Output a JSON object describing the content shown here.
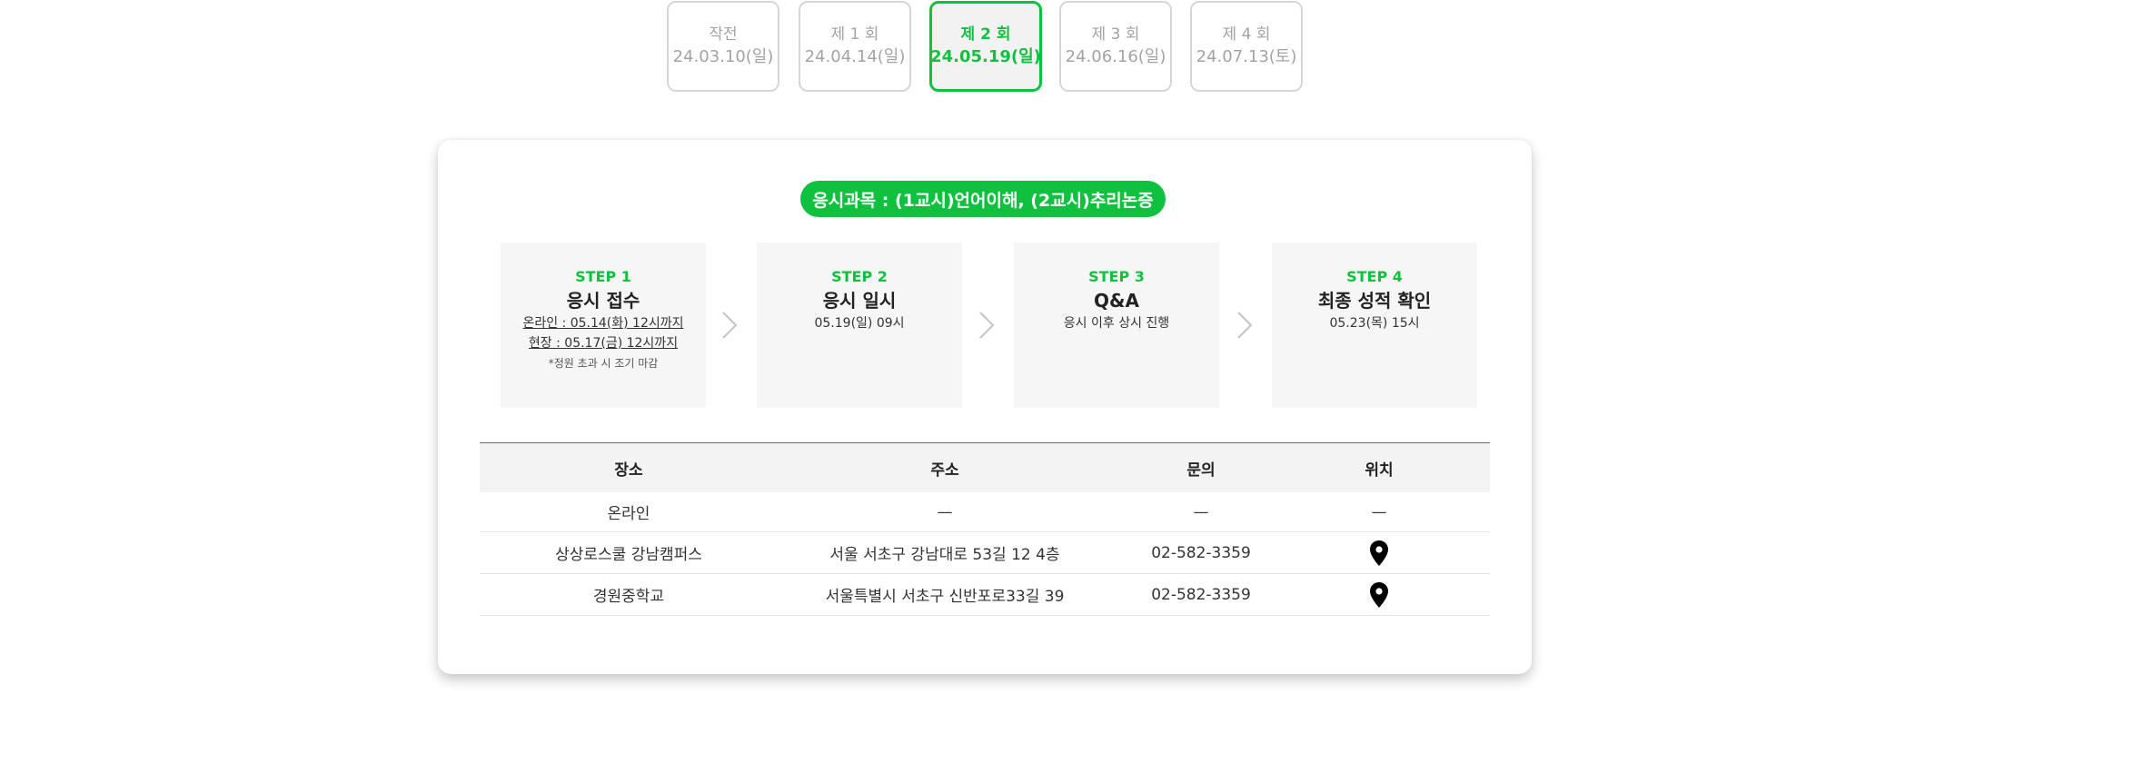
{
  "tabs": [
    {
      "label": "작전",
      "date": "24.03.10(일)",
      "active": false
    },
    {
      "label": "제 1 회",
      "date": "24.04.14(일)",
      "active": false
    },
    {
      "label": "제 2 회",
      "date": "24.05.19(일)",
      "active": true
    },
    {
      "label": "제 3 회",
      "date": "24.06.16(일)",
      "active": false
    },
    {
      "label": "제 4 회",
      "date": "24.07.13(토)",
      "active": false
    }
  ],
  "subject_banner": "응시과목 : (1교시)언어이해, (2교시)추리논증",
  "steps": [
    {
      "label": "STEP 1",
      "title": "응시 접수",
      "lines": [
        "온라인 : 05.14(화) 12시까지",
        "현장 : 05.17(금) 12시까지"
      ],
      "note": "*정원 초과 시 조기 마감"
    },
    {
      "label": "STEP 2",
      "title": "응시 일시",
      "lines": [
        "05.19(일) 09시"
      ]
    },
    {
      "label": "STEP 3",
      "title": "Q&A",
      "lines": [
        "응시 이후 상시 진행"
      ]
    },
    {
      "label": "STEP 4",
      "title": "최종 성적 확인",
      "lines": [
        "05.23(목) 15시"
      ]
    }
  ],
  "table": {
    "headers": [
      "장소",
      "주소",
      "문의",
      "위치"
    ],
    "rows": [
      {
        "place": "온라인",
        "address": "—",
        "contact": "—",
        "location": "—"
      },
      {
        "place": "상상로스쿨 강남캠퍼스",
        "address": "서울 서초구 강남대로 53길 12 4층",
        "contact": "02-582-3359",
        "location_icon": "map-pin-icon"
      },
      {
        "place": "경원중학교",
        "address": "서울특별시 서초구 신반포로33길 39",
        "contact": "02-582-3359",
        "location_icon": "map-pin-icon"
      }
    ]
  },
  "colors": {
    "accent": "#10c13f",
    "border": "#d6d6d6",
    "muted": "#a3a3a3",
    "panel": "#f6f6f6"
  }
}
